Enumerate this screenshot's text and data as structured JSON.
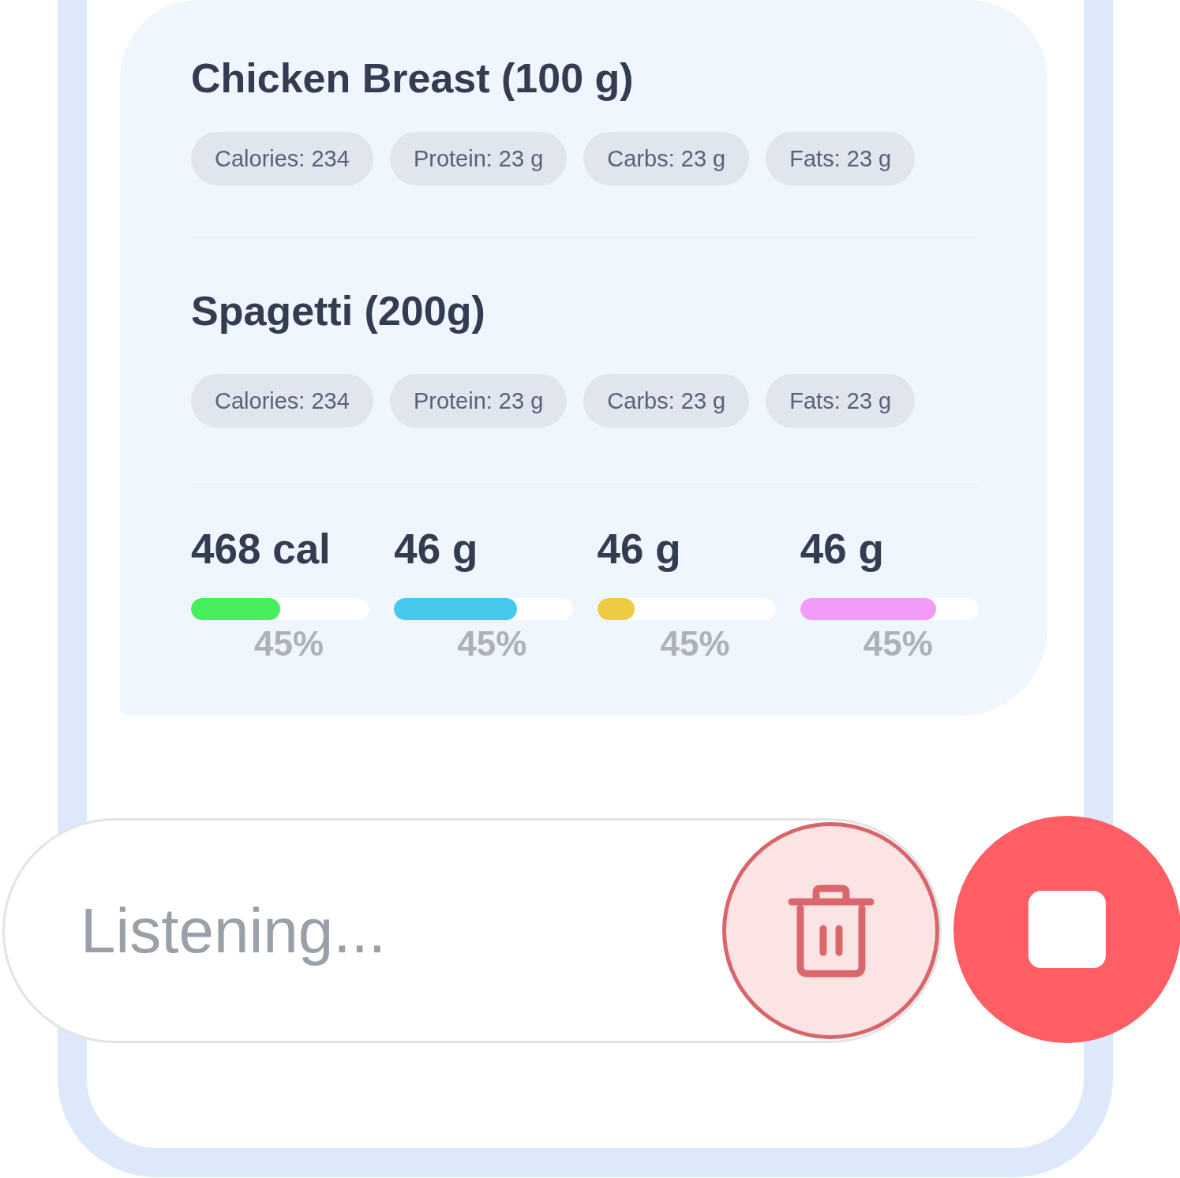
{
  "foods": [
    {
      "name": "Chicken Breast (100 g)",
      "nutrients": [
        "Calories: 234",
        "Protein: 23 g",
        "Carbs: 23 g",
        "Fats: 23 g"
      ]
    },
    {
      "name": "Spagetti (200g)",
      "nutrients": [
        "Calories: 234",
        "Protein: 23 g",
        "Carbs: 23 g",
        "Fats: 23 g"
      ]
    }
  ],
  "totals": [
    {
      "value": "468 cal",
      "level": 0.5,
      "color": "#47ef5c",
      "percent": "45%"
    },
    {
      "value": "46 g",
      "level": 0.69,
      "color": "#45caee",
      "percent": "45%"
    },
    {
      "value": "46 g",
      "level": 0.21,
      "color": "#eecb44",
      "percent": "45%"
    },
    {
      "value": "46 g",
      "level": 0.76,
      "color": "#f39bf9",
      "percent": "45%"
    }
  ],
  "voice_input": {
    "status": "Listening..."
  }
}
